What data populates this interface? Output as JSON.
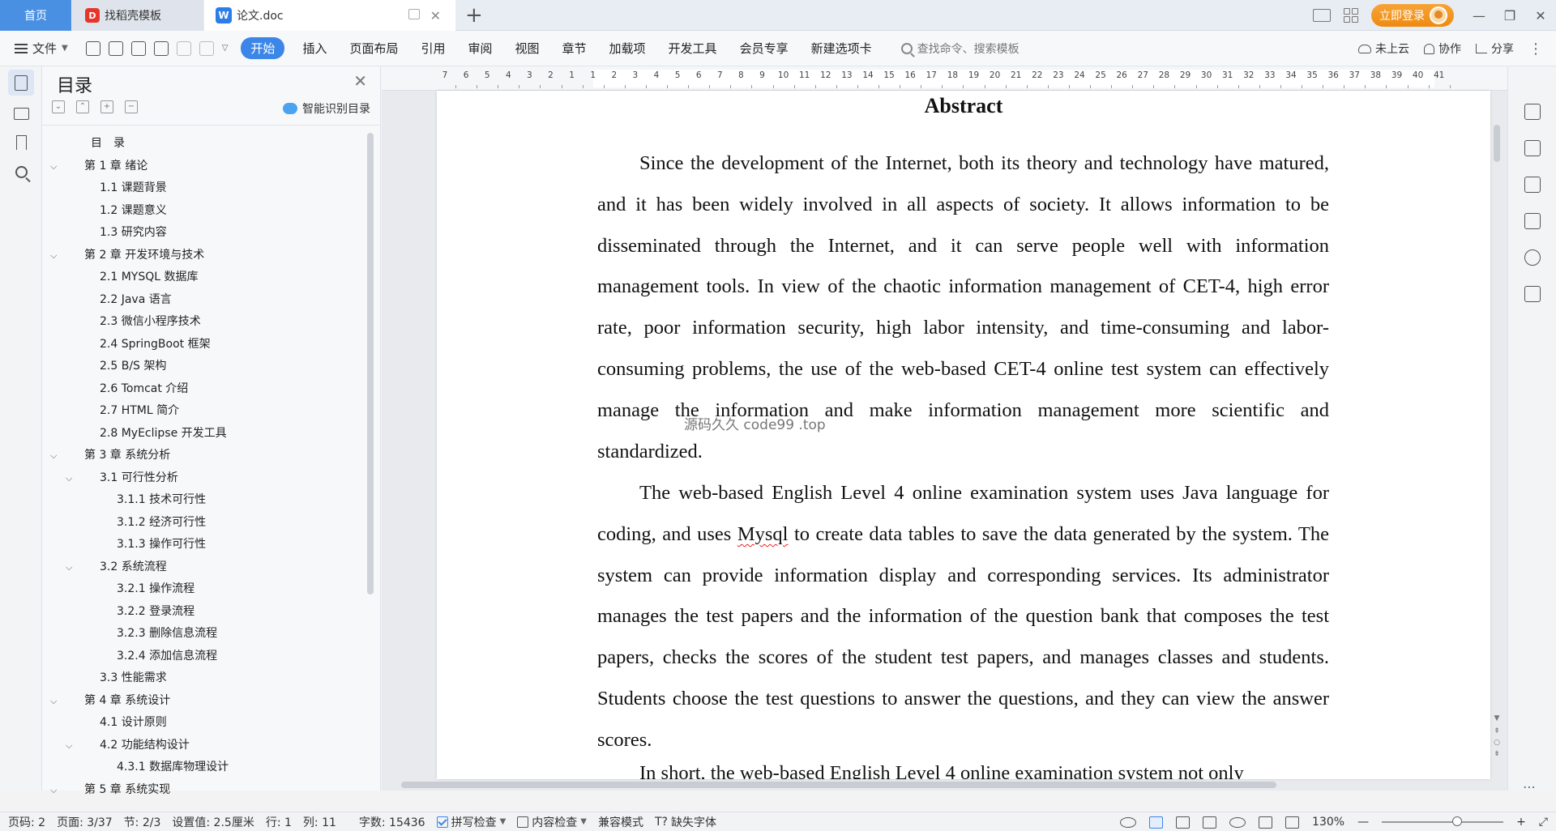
{
  "tabs": {
    "home": "首页",
    "daoke": "找稻壳模板",
    "doc": "论文.doc"
  },
  "titlebar": {
    "login": "立即登录"
  },
  "menu": {
    "file": "文件",
    "tabs": [
      "开始",
      "插入",
      "页面布局",
      "引用",
      "审阅",
      "视图",
      "章节",
      "加载项",
      "开发工具",
      "会员专享",
      "新建选项卡"
    ],
    "search_placeholder": "查找命令、搜索模板",
    "cloud": "未上云",
    "collab": "协作",
    "share": "分享"
  },
  "toc": {
    "title": "目录",
    "smart": "智能识别目录",
    "items": [
      {
        "text": "目　录",
        "level": 0,
        "chev": false
      },
      {
        "text": "第 1 章  绪论",
        "level": 0,
        "chev": true
      },
      {
        "text": "1.1  课题背景",
        "level": 1,
        "chev": false
      },
      {
        "text": "1.2  课题意义",
        "level": 1,
        "chev": false
      },
      {
        "text": "1.3  研究内容",
        "level": 1,
        "chev": false
      },
      {
        "text": "第 2 章  开发环境与技术",
        "level": 0,
        "chev": true
      },
      {
        "text": "2.1 MYSQL 数据库",
        "level": 1,
        "chev": false
      },
      {
        "text": "2.2 Java 语言",
        "level": 1,
        "chev": false
      },
      {
        "text": "2.3  微信小程序技术",
        "level": 1,
        "chev": false
      },
      {
        "text": "2.4 SpringBoot 框架",
        "level": 1,
        "chev": false
      },
      {
        "text": "2.5 B/S 架构",
        "level": 1,
        "chev": false
      },
      {
        "text": "2.6 Tomcat  介绍",
        "level": 1,
        "chev": false
      },
      {
        "text": "2.7 HTML 简介",
        "level": 1,
        "chev": false
      },
      {
        "text": "2.8 MyEclipse 开发工具",
        "level": 1,
        "chev": false
      },
      {
        "text": "第 3 章  系统分析",
        "level": 0,
        "chev": true
      },
      {
        "text": "3.1  可行性分析",
        "level": 1,
        "chev": true
      },
      {
        "text": "3.1.1  技术可行性",
        "level": 2,
        "chev": false
      },
      {
        "text": "3.1.2  经济可行性",
        "level": 2,
        "chev": false
      },
      {
        "text": "3.1.3  操作可行性",
        "level": 2,
        "chev": false
      },
      {
        "text": "3.2  系统流程",
        "level": 1,
        "chev": true
      },
      {
        "text": "3.2.1  操作流程",
        "level": 2,
        "chev": false
      },
      {
        "text": "3.2.2  登录流程",
        "level": 2,
        "chev": false
      },
      {
        "text": "3.2.3  删除信息流程",
        "level": 2,
        "chev": false
      },
      {
        "text": "3.2.4  添加信息流程",
        "level": 2,
        "chev": false
      },
      {
        "text": "3.3  性能需求",
        "level": 1,
        "chev": false
      },
      {
        "text": "第 4 章  系统设计",
        "level": 0,
        "chev": true
      },
      {
        "text": "4.1  设计原则",
        "level": 1,
        "chev": false
      },
      {
        "text": "4.2  功能结构设计",
        "level": 1,
        "chev": true
      },
      {
        "text": "4.3.1  数据库物理设计",
        "level": 2,
        "chev": false
      },
      {
        "text": "第 5 章  系统实现",
        "level": 0,
        "chev": true
      }
    ]
  },
  "ruler": {
    "labels": [
      "7",
      "6",
      "5",
      "4",
      "3",
      "2",
      "1",
      "1",
      "2",
      "3",
      "4",
      "5",
      "6",
      "7",
      "8",
      "9",
      "10",
      "11",
      "12",
      "13",
      "14",
      "15",
      "16",
      "17",
      "18",
      "19",
      "20",
      "21",
      "22",
      "23",
      "24",
      "25",
      "26",
      "27",
      "28",
      "29",
      "30",
      "31",
      "32",
      "33",
      "34",
      "35",
      "36",
      "37",
      "38",
      "39",
      "40",
      "41"
    ]
  },
  "document": {
    "title": "Abstract",
    "para1": "Since the development of the Internet, both its theory and technology have matured, and it has been widely involved in all aspects of society. It allows information to be disseminated through the Internet, and it can serve people well with information management tools. In view of the chaotic information management of CET-4, high error rate, poor information security, high labor intensity, and time-consuming and labor-consuming problems, the use of the web-based CET-4 online test system can effectively manage the information and make information management more scientific and standardized.",
    "para2_a": "The web-based English Level 4 online examination system uses Java language for coding, and uses ",
    "para2_mysql": "Mysql",
    "para2_b": " to create data tables to save the data generated by the system. The system can provide information display and corresponding services. Its administrator manages the test papers and the information of the question bank that composes the test papers, checks the scores of the student test papers, and manages classes and students. Students choose the test questions to answer the questions, and they can view the answer scores.",
    "para3": "In short, the web-based English Level 4 online examination system not only",
    "watermark": "源码久久 code99 .top"
  },
  "status": {
    "page_num": "页码: 2",
    "page": "页面: 3/37",
    "section": "节: 2/3",
    "setting": "设置值: 2.5厘米",
    "row": "行: 1",
    "col": "列: 11",
    "words": "字数: 15436",
    "spell": "拼写检查",
    "content": "内容检查",
    "compat": "兼容模式",
    "missing_font": "缺失字体",
    "zoom": "130%",
    "zoom_value": 130
  }
}
